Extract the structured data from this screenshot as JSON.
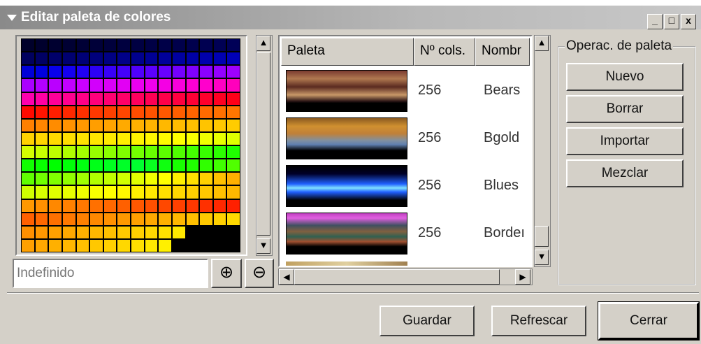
{
  "window": {
    "title": "Editar paleta de colores",
    "min": "_",
    "max": "□",
    "close": "x"
  },
  "palette_grid": {
    "rows": [
      [
        "#00002a",
        "#00002d",
        "#000030",
        "#000033",
        "#000036",
        "#000039",
        "#00003c",
        "#00003f",
        "#000042",
        "#000045",
        "#000048",
        "#00004b",
        "#00004e",
        "#000051",
        "#000054",
        "#000057"
      ],
      [
        "#00005e",
        "#000064",
        "#00006a",
        "#000070",
        "#000076",
        "#00007c",
        "#000082",
        "#000088",
        "#00008e",
        "#000094",
        "#00009a",
        "#0000a0",
        "#0000a6",
        "#0000ac",
        "#0000b2",
        "#0000b8"
      ],
      [
        "#0000d8",
        "#0000e0",
        "#0800ec",
        "#1400f0",
        "#2000f4",
        "#2c00f6",
        "#3800f8",
        "#4400fa",
        "#5000fc",
        "#5c00fe",
        "#6800ff",
        "#7400ff",
        "#8000ff",
        "#8a00ff",
        "#9400ff",
        "#9e00ff"
      ],
      [
        "#aa00ff",
        "#b200ff",
        "#ba00ff",
        "#c200ff",
        "#ca00ff",
        "#d200fc",
        "#da00f8",
        "#e200f4",
        "#ea00f0",
        "#f000ec",
        "#f400e4",
        "#f800dc",
        "#fc00d4",
        "#ff00cc",
        "#ff00c4",
        "#ff00bc"
      ],
      [
        "#ff00ae",
        "#ff00a4",
        "#ff009a",
        "#ff0090",
        "#ff0086",
        "#ff007c",
        "#ff0072",
        "#ff0068",
        "#ff005e",
        "#ff0054",
        "#ff004a",
        "#ff0040",
        "#ff0036",
        "#ff002c",
        "#ff0022",
        "#ff0018"
      ],
      [
        "#ff0a00",
        "#ff1400",
        "#ff1e00",
        "#ff2800",
        "#ff3000",
        "#ff3800",
        "#ff4000",
        "#ff4600",
        "#ff4c00",
        "#ff5200",
        "#ff5800",
        "#ff5e00",
        "#ff6400",
        "#ff6a00",
        "#ff7000",
        "#ff7600"
      ],
      [
        "#ff8000",
        "#ff8600",
        "#ff8c00",
        "#ff9200",
        "#ff9800",
        "#ff9e00",
        "#ffa400",
        "#ffaa00",
        "#ffb000",
        "#ffb400",
        "#ffb800",
        "#ffbc00",
        "#ffc000",
        "#ffc400",
        "#ffc800",
        "#ffcc00"
      ],
      [
        "#ffd200",
        "#ffd600",
        "#ffda00",
        "#ffde00",
        "#ffe200",
        "#ffe600",
        "#ffea00",
        "#ffee00",
        "#fff200",
        "#fff600",
        "#fffa00",
        "#ffff00",
        "#f8ff00",
        "#f0ff00",
        "#e8ff00",
        "#e0ff00"
      ],
      [
        "#d4ff00",
        "#c8ff00",
        "#bcff00",
        "#b0ff00",
        "#a4ff00",
        "#98ff00",
        "#8cff00",
        "#80ff00",
        "#74ff00",
        "#68ff00",
        "#5cff00",
        "#50ff00",
        "#44ff00",
        "#38ff00",
        "#2cff00",
        "#20ff00"
      ],
      [
        "#10ff00",
        "#08ff00",
        "#00ff00",
        "#00ff08",
        "#00ff10",
        "#00ff18",
        "#00ff20",
        "#00ff28",
        "#00ff30",
        "#08ff20",
        "#10ff10",
        "#18ff00",
        "#20ff00",
        "#30ff00",
        "#40ff00",
        "#50ff00"
      ],
      [
        "#60ff00",
        "#70ff00",
        "#80ff00",
        "#90ff00",
        "#a0ff00",
        "#b0ff00",
        "#c0ff00",
        "#d0ff00",
        "#e0ff00",
        "#f0ff00",
        "#ffff00",
        "#fff000",
        "#ffe000",
        "#ffd000",
        "#ffc000",
        "#ffb000"
      ],
      [
        "#d0ff00",
        "#d8ff00",
        "#e0ff00",
        "#e8ff00",
        "#f0ff00",
        "#f8ff00",
        "#ffff00",
        "#fff800",
        "#fff000",
        "#ffe800",
        "#ffe000",
        "#ffd800",
        "#ffd000",
        "#ffc800",
        "#ffc000",
        "#ffb800"
      ],
      [
        "#ff9800",
        "#ff9000",
        "#ff8800",
        "#ff8000",
        "#ff7800",
        "#ff7000",
        "#ff6800",
        "#ff6000",
        "#ff5800",
        "#ff5000",
        "#ff4800",
        "#ff4000",
        "#ff3800",
        "#ff3000",
        "#ff2800",
        "#ff2000"
      ],
      [
        "#ff6000",
        "#ff6800",
        "#ff7000",
        "#ff7800",
        "#ff8000",
        "#ff8800",
        "#ff9000",
        "#ff9800",
        "#ffa000",
        "#ffa800",
        "#ffb000",
        "#ffb800",
        "#ffc000",
        "#ffc800",
        "#ffd000",
        "#ffd800"
      ],
      [
        "#ff9000",
        "#ff9800",
        "#ffa000",
        "#ffa800",
        "#ffb000",
        "#ffb800",
        "#ffc000",
        "#ffc800",
        "#ffd000",
        "#ffd800",
        "#ffe000",
        "#ffe800",
        "#000000",
        "#000000",
        "#000000",
        "#000000"
      ],
      [
        "#ffa000",
        "#ffa800",
        "#ffb000",
        "#ffb800",
        "#ffc000",
        "#ffc800",
        "#ffd000",
        "#ffd800",
        "#ffe000",
        "#ffe800",
        "#fff000",
        "#000000",
        "#000000",
        "#000000",
        "#000000",
        "#000000"
      ]
    ]
  },
  "color_name_field": {
    "placeholder": "Indefinido"
  },
  "zoom_in_icon": "zoom-in-icon",
  "zoom_out_icon": "zoom-out-icon",
  "palette_list": {
    "headers": [
      "Paleta",
      "Nº cols.",
      "Nombr"
    ],
    "rows": [
      {
        "count": "256",
        "name": "Bears",
        "preview": "linear-gradient(180deg,#7a3a30 0%,#b07850 20%,#5a2a20 40%,#c89868 60%,#301818 75%,#000 80%,#000 100%)"
      },
      {
        "count": "256",
        "name": "Bgold",
        "preview": "linear-gradient(180deg,#8a5a20 0%,#d09030 20%,#c08038 38%,#8090a0 55%,#6080b0 65%,#000 80%,#000 100%)"
      },
      {
        "count": "256",
        "name": "Blues",
        "preview": "linear-gradient(180deg,#000 0%,#000028 20%,#2060ff 45%,#80e0ff 55%,#2060ff 65%,#000 85%,#000 100%)"
      },
      {
        "count": "256",
        "name": "Bordeı",
        "preview": "linear-gradient(180deg,#c040c0 0%,#e060e0 12%,#405060 30%,#806040 45%,#306050 58%,#a05030 70%,#000 82%,#000 100%)"
      }
    ]
  },
  "operations": {
    "title": "Operac. de paleta",
    "buttons": [
      "Nuevo",
      "Borrar",
      "Importar",
      "Mezclar"
    ]
  },
  "footer": {
    "save": "Guardar",
    "refresh": "Refrescar",
    "close": "Cerrar"
  },
  "scroll": {
    "up": "▲",
    "down": "▼",
    "left": "◀",
    "right": "▶"
  }
}
